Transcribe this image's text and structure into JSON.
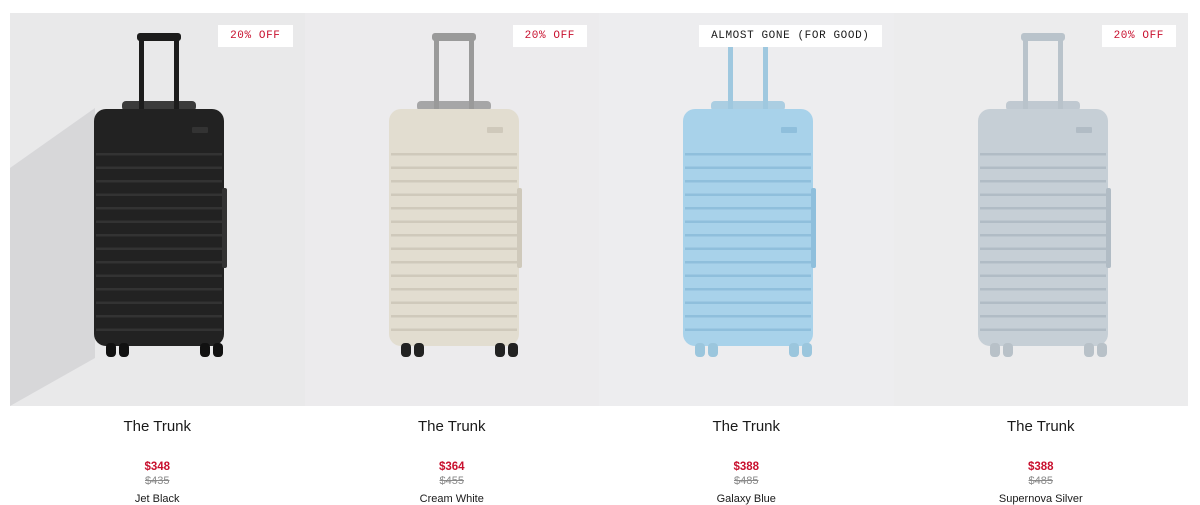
{
  "products": [
    {
      "name": "The Trunk",
      "badge": "20% OFF",
      "price": "$348",
      "was_price": "$435",
      "color": "Jet Black",
      "bg": "#e9e9ea",
      "body_color": "#222222",
      "rib_color": "#333333",
      "handle_color": "#1c1c1c",
      "wheel_color": "#111111"
    },
    {
      "name": "The Trunk",
      "badge": "20% OFF",
      "price": "$364",
      "was_price": "$455",
      "color": "Cream White",
      "bg": "#ecebed",
      "body_color": "#e2ddd0",
      "rib_color": "#cfc9bb",
      "handle_color": "#9a9a9a",
      "wheel_color": "#222222"
    },
    {
      "name": "The Trunk",
      "badge": "ALMOST GONE (FOR GOOD)",
      "price": "$388",
      "was_price": "$485",
      "color": "Galaxy Blue",
      "bg": "#ededef",
      "body_color": "#a8d2ea",
      "rib_color": "#8fbfdc",
      "handle_color": "#9fc8df",
      "wheel_color": "#9bc6dd"
    },
    {
      "name": "The Trunk",
      "badge": "20% OFF",
      "price": "$388",
      "was_price": "$485",
      "color": "Supernova Silver",
      "bg": "#ececed",
      "body_color": "#c6cfd6",
      "rib_color": "#b1bcc5",
      "handle_color": "#b9c3cb",
      "wheel_color": "#b8c1c8"
    }
  ]
}
